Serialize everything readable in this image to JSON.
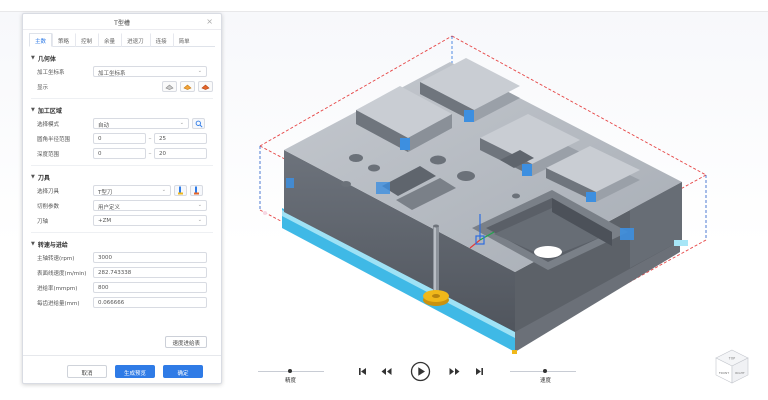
{
  "panel": {
    "title": "T型槽",
    "close": "×",
    "tabs": [
      {
        "label": "主数",
        "active": true
      },
      {
        "label": "策略",
        "active": false
      },
      {
        "label": "控制",
        "active": false
      },
      {
        "label": "余量",
        "active": false
      },
      {
        "label": "进退刀",
        "active": false
      },
      {
        "label": "连接",
        "active": false
      },
      {
        "label": "简单",
        "active": false
      }
    ],
    "geometry": {
      "title": "几何体",
      "coord_label": "加工坐标系",
      "coord_value": "加工坐标系",
      "display_label": "显示"
    },
    "region": {
      "title": "加工区域",
      "mode_label": "选择模式",
      "mode_value": "自动",
      "radius_label": "圆角半径范围",
      "radius_min": "0",
      "radius_max": "25",
      "depth_label": "深度范围",
      "depth_min": "0",
      "depth_max": "20"
    },
    "tool": {
      "title": "刀具",
      "select_label": "选择刀具",
      "select_value": "T型刀",
      "params_label": "切削参数",
      "params_value": "用户定义",
      "axis_label": "刀轴",
      "axis_value": "+ZM"
    },
    "speed": {
      "title": "转速与进给",
      "spindle_label": "主轴转速(rpm)",
      "spindle_value": "3000",
      "surface_label": "表面线速度(m/min)",
      "surface_value": "282.743338",
      "feed_label": "进给率(mmpm)",
      "feed_value": "800",
      "tooth_label": "每齿进给量(mm)",
      "tooth_value": "0.066666",
      "recommend_button": "速度进给表"
    },
    "footer": {
      "cancel": "取消",
      "preview": "生成预览",
      "ok": "确定"
    }
  },
  "playback": {
    "left_label": "精度",
    "right_label": "速度"
  },
  "nav_cube": {
    "top": "TOP",
    "front": "FRONT",
    "right": "RIGHT"
  },
  "colors": {
    "accent": "#2f7be6",
    "part": "#7e858f",
    "part_top": "#b9bec5",
    "highlight": "#3d8fe0",
    "cyan": "#3fc4e8",
    "bbox_dash": "#e64545",
    "tool_gold": "#f0b81a"
  }
}
